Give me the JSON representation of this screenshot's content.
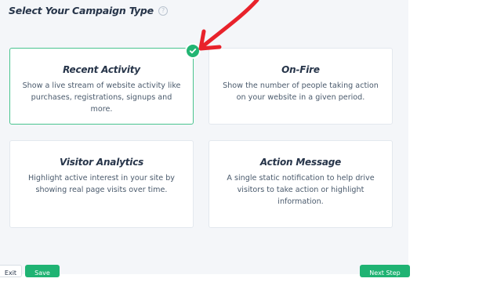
{
  "header": {
    "title": "Select Your Campaign Type",
    "help_icon": "question-circle-icon"
  },
  "campaign_types": [
    {
      "title": "Recent Activity",
      "description": "Show a live stream of website activity like purchases, registrations, signups and more.",
      "selected": true
    },
    {
      "title": "On-Fire",
      "description": "Show the number of people taking action on your website in a given period.",
      "selected": false
    },
    {
      "title": "Visitor Analytics",
      "description": "Highlight active interest in your site by showing real page visits over time.",
      "selected": false
    },
    {
      "title": "Action Message",
      "description": "A single static notification to help drive visitors to take action or highlight information.",
      "selected": false
    }
  ],
  "annotation": {
    "icon": "red-arrow-icon",
    "color": "#e8222b"
  },
  "selected_badge": {
    "icon": "checkmark-icon",
    "color": "#22b573"
  },
  "footer": {
    "exit_label": "Exit",
    "save_label": "Save",
    "next_label": "Next Step"
  },
  "colors": {
    "accent": "#1fb373",
    "panel_bg": "#f4f6f9",
    "selected_border": "#49c48f"
  }
}
